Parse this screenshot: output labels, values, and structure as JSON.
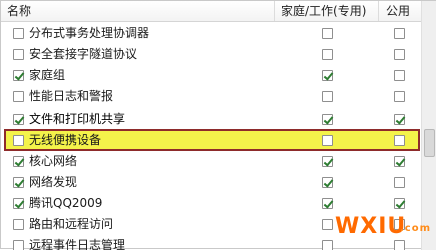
{
  "columns": {
    "name": "名称",
    "home": "家庭/工作(专用)",
    "public": "公用"
  },
  "rows": [
    {
      "label": "分布式事务处理协调器",
      "name_checked": false,
      "home_checked": false,
      "public_checked": false
    },
    {
      "label": "安全套接字隧道协议",
      "name_checked": false,
      "home_checked": false,
      "public_checked": false
    },
    {
      "label": "家庭组",
      "name_checked": true,
      "home_checked": true,
      "public_checked": false
    },
    {
      "label": "性能日志和警报",
      "name_checked": false,
      "home_checked": false,
      "public_checked": false
    },
    {
      "label": "文件和打印机共享",
      "name_checked": true,
      "home_checked": true,
      "public_checked": true,
      "highlighted": true
    },
    {
      "label": "无线便携设备",
      "name_checked": false,
      "home_checked": false,
      "public_checked": false
    },
    {
      "label": "核心网络",
      "name_checked": true,
      "home_checked": true,
      "public_checked": true
    },
    {
      "label": "网络发现",
      "name_checked": true,
      "home_checked": true,
      "public_checked": false
    },
    {
      "label": "腾讯QQ2009",
      "name_checked": true,
      "home_checked": true,
      "public_checked": true
    },
    {
      "label": "路由和远程访问",
      "name_checked": false,
      "home_checked": false,
      "public_checked": false
    },
    {
      "label": "远程事件日志管理",
      "name_checked": false,
      "home_checked": false,
      "public_checked": false
    }
  ],
  "watermark": {
    "part1": "WXIU",
    "part2": ".com"
  },
  "colors": {
    "highlight_fill": "#f4f34a",
    "highlight_border": "#8e2b2b",
    "check": "#2e7d32",
    "watermark": "#ff6a00"
  }
}
